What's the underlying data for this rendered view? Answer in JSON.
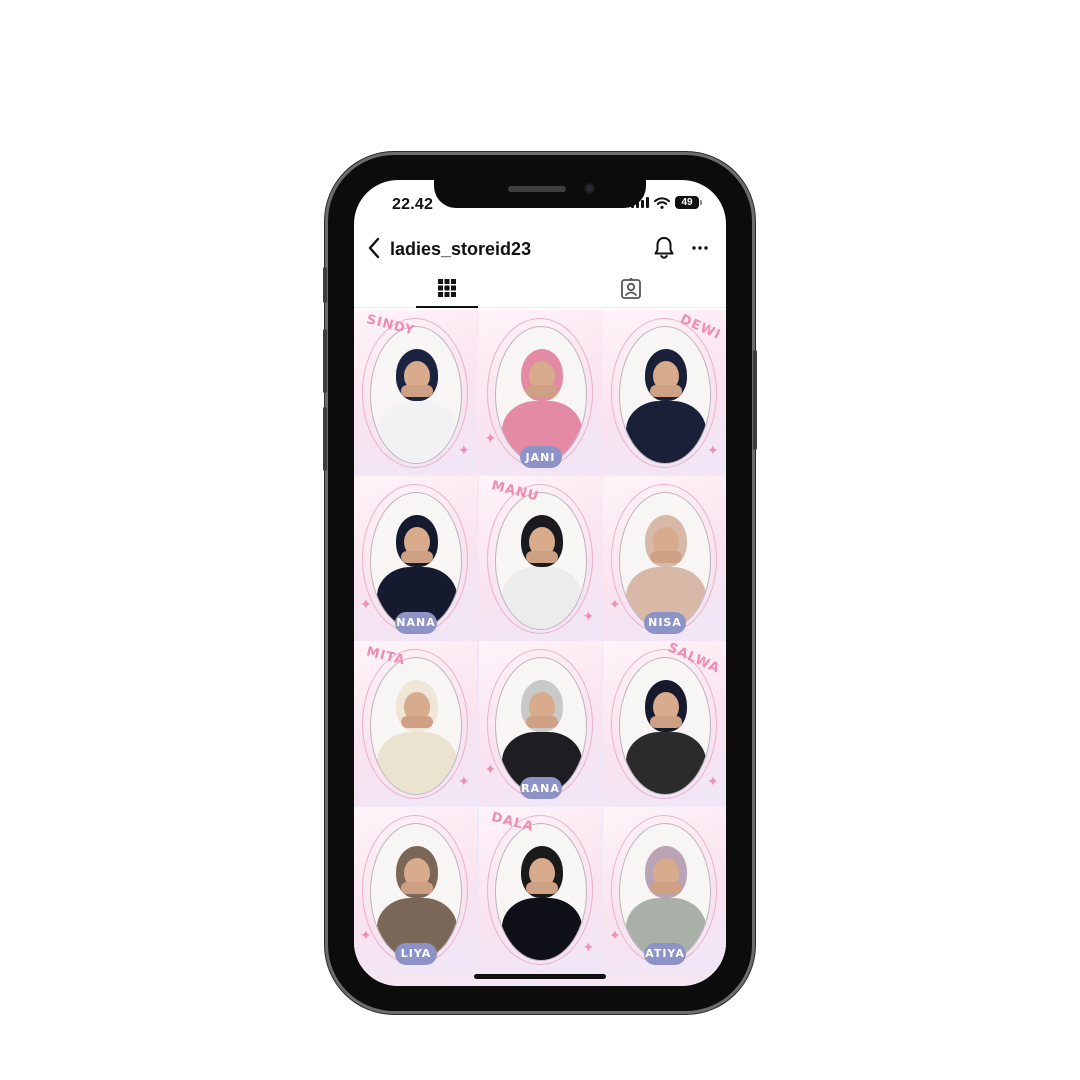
{
  "status_bar": {
    "time": "22.42",
    "battery": "49",
    "icons": [
      "signal-icon",
      "wifi-icon",
      "battery-icon"
    ]
  },
  "header": {
    "username": "ladies_storeid23",
    "icons": [
      "back-arrow-icon",
      "bell-icon",
      "more-icon"
    ]
  },
  "tabs": [
    {
      "icon": "grid-icon",
      "selected": true
    },
    {
      "icon": "tagged-icon",
      "selected": false
    }
  ],
  "colors": {
    "name_tag": "#8e93c7",
    "accent_pink": "#ee8db1",
    "feed_background": "#f6e4f4"
  },
  "posts": [
    {
      "name_tag": "",
      "scribble": "SINDY",
      "hijab_color": "#1c2340",
      "outfit_color": "#f2f2f4"
    },
    {
      "name_tag": "JANI",
      "scribble": "",
      "hijab_color": "#e48aa5",
      "outfit_color": "#e48aa5"
    },
    {
      "name_tag": "",
      "scribble": "DEWI",
      "hijab_color": "#1a2038",
      "outfit_color": "#1a2038"
    },
    {
      "name_tag": "NANA",
      "scribble": "",
      "hijab_color": "#161a2e",
      "outfit_color": "#161a2e"
    },
    {
      "name_tag": "",
      "scribble": "MANU",
      "hijab_color": "#1b1b1f",
      "outfit_color": "#ececec"
    },
    {
      "name_tag": "NISA",
      "scribble": "",
      "hijab_color": "#d8b9a8",
      "outfit_color": "#d8b9a8"
    },
    {
      "name_tag": "",
      "scribble": "MITA",
      "hijab_color": "#efe6d8",
      "outfit_color": "#ece2d0"
    },
    {
      "name_tag": "RANA",
      "scribble": "",
      "hijab_color": "#c9c9c9",
      "outfit_color": "#1e1e22"
    },
    {
      "name_tag": "",
      "scribble": "SALWA",
      "hijab_color": "#161a2c",
      "outfit_color": "#2b2b2b"
    },
    {
      "name_tag": "LIYA",
      "scribble": "",
      "hijab_color": "#7a6757",
      "outfit_color": "#7a6757"
    },
    {
      "name_tag": "",
      "scribble": "DALA",
      "hijab_color": "#1a1a1a",
      "outfit_color": "#0f1018"
    },
    {
      "name_tag": "ATIYA",
      "scribble": "",
      "hijab_color": "#b9a3b4",
      "outfit_color": "#a8b0a8"
    }
  ]
}
